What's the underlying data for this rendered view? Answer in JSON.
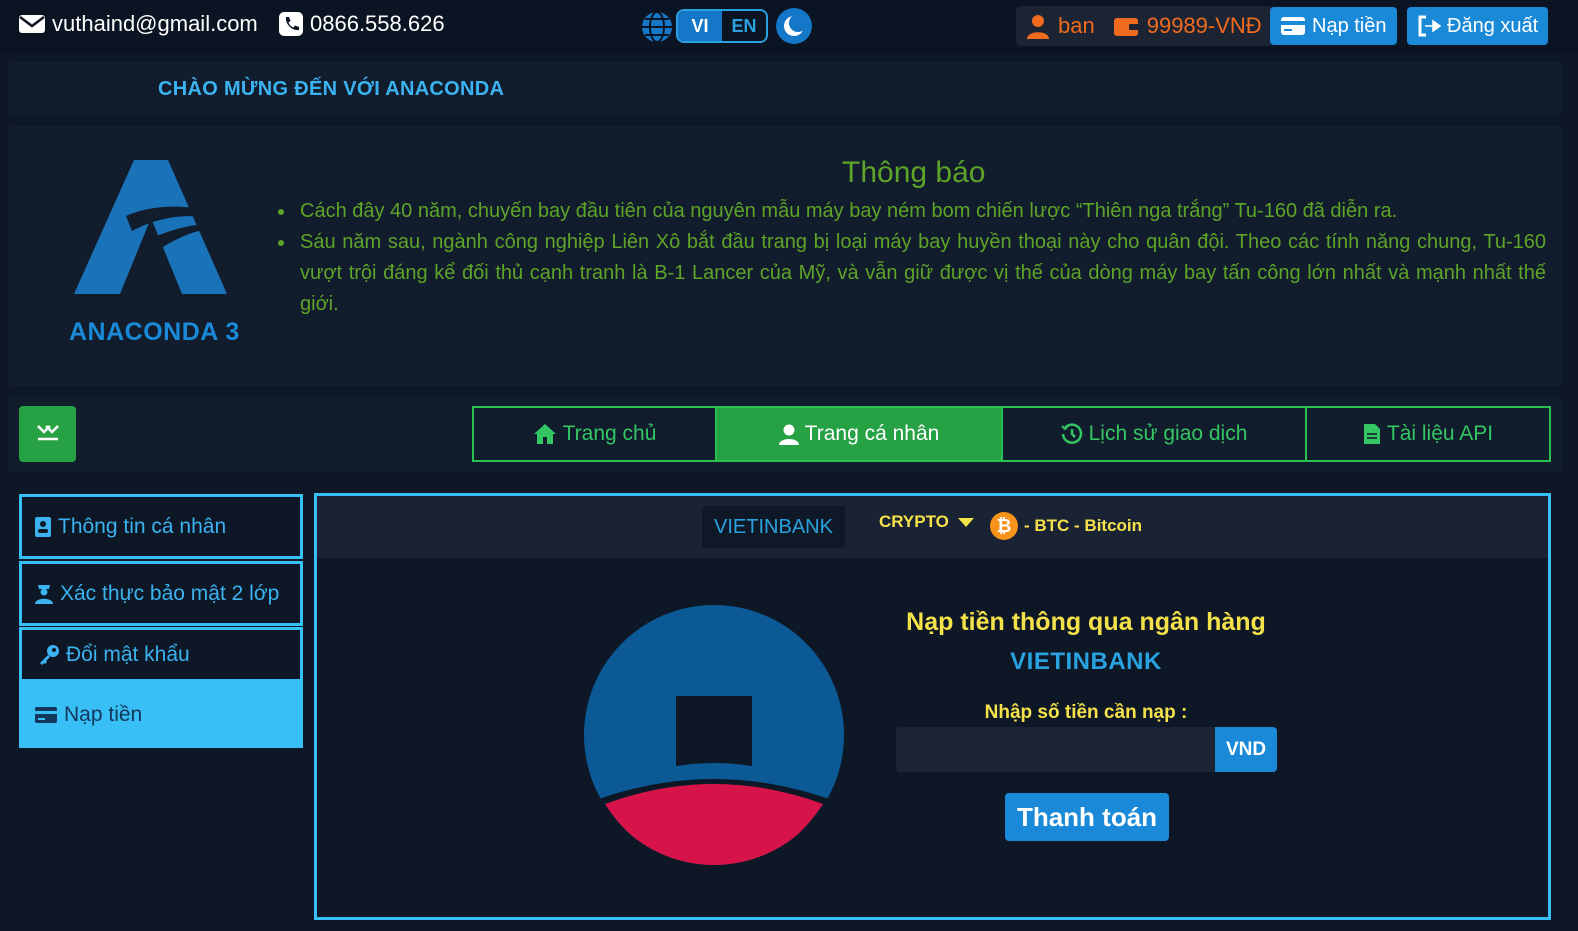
{
  "topbar": {
    "email": "vuthaind@gmail.com",
    "phone": "0866.558.626",
    "lang_vi": "VI",
    "lang_en": "EN",
    "username": "ban",
    "balance": "99989-VNĐ",
    "deposit_label": "Nạp tiền",
    "logout_label": "Đăng xuất"
  },
  "welcome": "CHÀO MỪNG ĐẾN VỚI ANACONDA",
  "brand": {
    "name": "ANACONDA 3"
  },
  "notice": {
    "title": "Thông báo",
    "items": [
      "Cách đây 40 năm, chuyến bay đầu tiên của nguyên mẫu máy bay ném bom chiến lược “Thiên nga trắng” Tu-160 đã diễn ra.",
      "Sáu năm sau, ngành công nghiệp Liên Xô bắt đầu trang bị loại máy bay huyền thoại này cho quân đội. Theo các tính năng chung, Tu-160 vượt trội đáng kể đối thủ cạnh tranh là B-1 Lancer của Mỹ, và vẫn giữ được vị thế của dòng máy bay tấn công lớn nhất và mạnh nhất thế giới."
    ]
  },
  "nav": {
    "tabs": [
      {
        "label": "Trang chủ",
        "icon": "home-icon"
      },
      {
        "label": "Trang cá nhân",
        "icon": "user-icon"
      },
      {
        "label": "Lịch sử giao dịch",
        "icon": "history-icon"
      },
      {
        "label": "Tài liệu API",
        "icon": "document-icon"
      }
    ],
    "active_index": 1
  },
  "sidebar": {
    "items": [
      {
        "label": "Thông tin cá nhân",
        "icon": "id-card-icon"
      },
      {
        "label": "Xác thực bảo mật 2 lớp",
        "icon": "shield-user-icon"
      },
      {
        "label": "Đổi mật khẩu",
        "icon": "key-icon"
      },
      {
        "label": "Nạp tiền",
        "icon": "credit-card-icon"
      }
    ],
    "active_index": 3
  },
  "payment": {
    "tab_bank": "VIETINBANK",
    "tab_crypto": "CRYPTO",
    "crypto_option": "- BTC - Bitcoin",
    "title": "Nạp tiền thông qua ngân hàng",
    "bank": "VIETINBANK",
    "amount_label": "Nhập số tiền cần nạp :",
    "amount_value": "",
    "currency": "VND",
    "submit_label": "Thanh toán"
  },
  "colors": {
    "background": "#0d1726",
    "accent_blue": "#1a8ad8",
    "accent_cyan": "#37c0f6",
    "accent_green": "#26a144",
    "notice_green": "#5ea428",
    "highlight_yellow": "#f5e14a",
    "balance_orange": "#f06b1e",
    "vietinbank_blue": "#0b5a96",
    "vietinbank_red": "#d6144a"
  }
}
